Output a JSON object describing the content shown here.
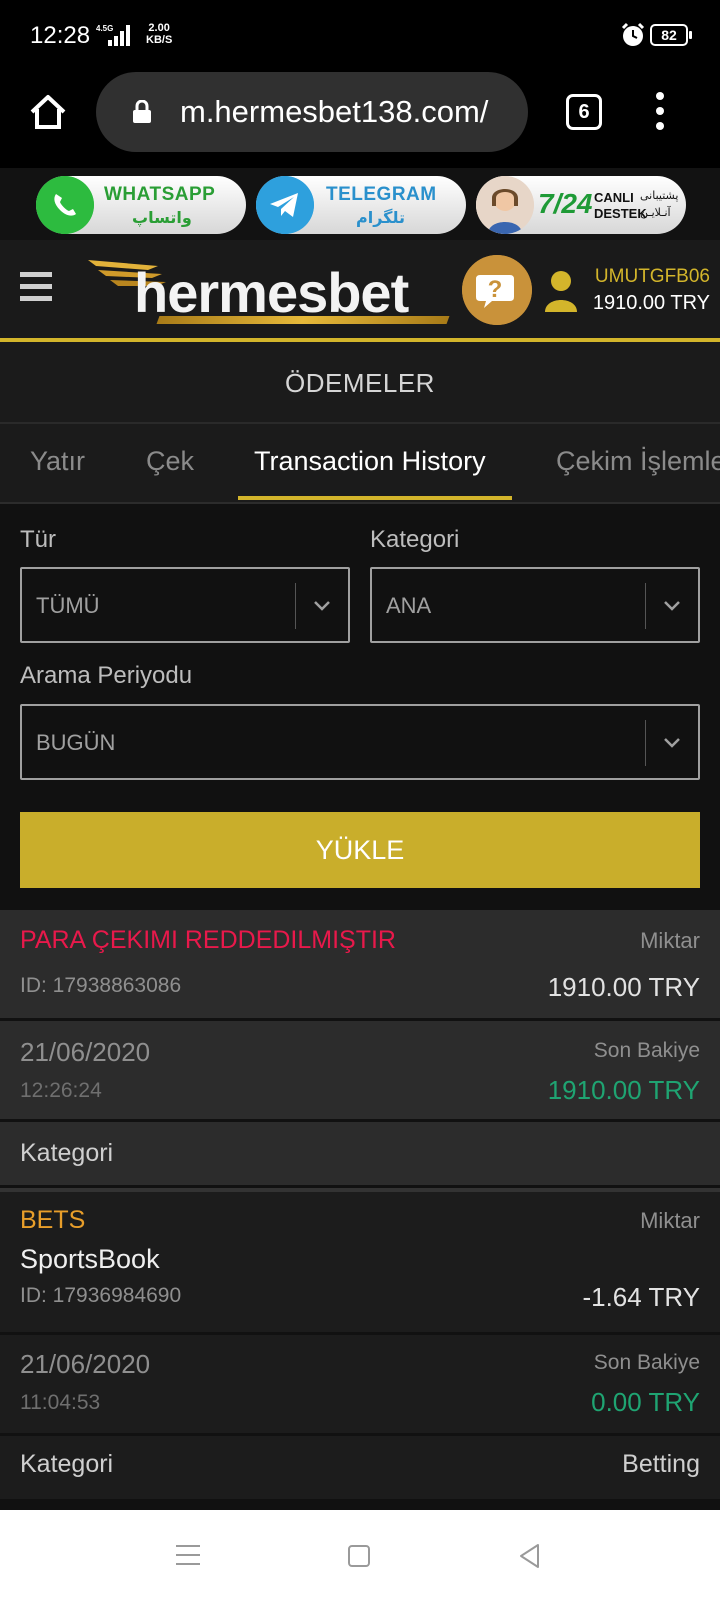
{
  "status_bar": {
    "time": "12:28",
    "network": "4.5G",
    "speed_value": "2.00",
    "speed_unit": "KB/S",
    "battery": "82"
  },
  "browser": {
    "url": "m.hermesbet138.com/",
    "tab_count": "6"
  },
  "promo": {
    "whatsapp_label": "WHATSAPP",
    "whatsapp_sub": "واتساپ",
    "telegram_label": "TELEGRAM",
    "telegram_sub": "تلگرام",
    "support_247": "7/24",
    "support_line1": "CANLI",
    "support_line2": "DESTEK",
    "support_fa1": "پشتیبانی",
    "support_fa2": "آنـلایـن"
  },
  "header": {
    "logo_text": "hermesbet",
    "username": "UMUTGFB06",
    "balance": "1910.00 TRY"
  },
  "page": {
    "title": "ÖDEMELER"
  },
  "tabs": [
    {
      "label": "Yatır"
    },
    {
      "label": "Çek"
    },
    {
      "label": "Transaction History"
    },
    {
      "label": "Çekim İşlemleri"
    }
  ],
  "filters": {
    "type_label": "Tür",
    "type_value": "TÜMÜ",
    "category_label": "Kategori",
    "category_value": "ANA",
    "period_label": "Arama Periyodu",
    "period_value": "BUGÜN",
    "load_button": "YÜKLE"
  },
  "transactions": [
    {
      "status": "PARA ÇEKIMI REDDEDILMIŞTIR",
      "amount_label": "Miktar",
      "id": "ID: 17938863086",
      "amount": "1910.00 TRY",
      "date": "21/06/2020",
      "time": "12:26:24",
      "balance_label": "Son Bakiye",
      "balance": "1910.00 TRY",
      "category_label": "Kategori",
      "category": ""
    },
    {
      "status": "BETS",
      "subtitle": "SportsBook",
      "amount_label": "Miktar",
      "id": "ID: 17936984690",
      "amount": "-1.64 TRY",
      "date": "21/06/2020",
      "time": "11:04:53",
      "balance_label": "Son Bakiye",
      "balance": "0.00 TRY",
      "category_label": "Kategori",
      "category": "Betting"
    }
  ]
}
